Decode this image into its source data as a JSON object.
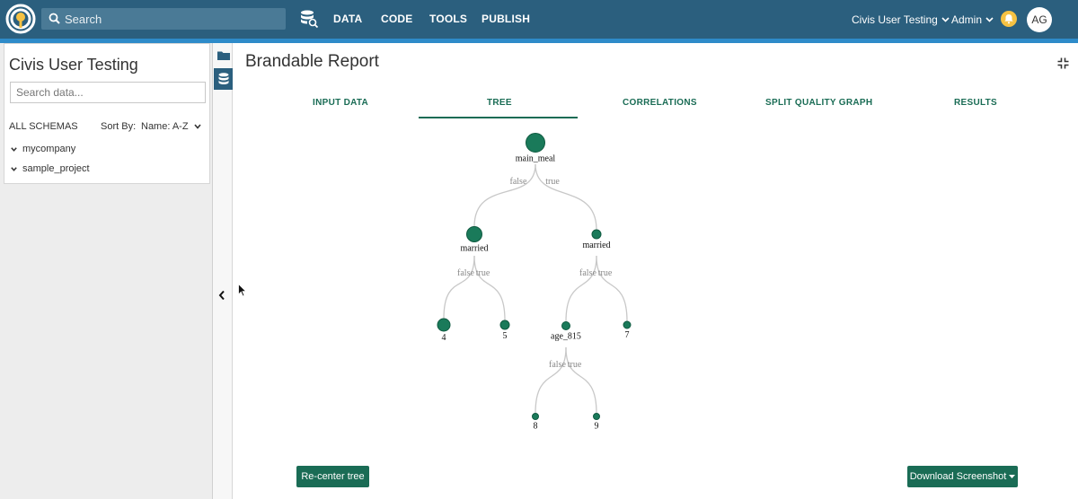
{
  "header": {
    "search_placeholder": "Search",
    "nav": [
      "DATA",
      "CODE",
      "TOOLS",
      "PUBLISH"
    ],
    "org_label": "Civis User Testing",
    "admin_label": "Admin",
    "avatar_initials": "AG"
  },
  "sidebar": {
    "title": "Civis User Testing",
    "search_placeholder": "Search data...",
    "all_schemas_label": "ALL SCHEMAS",
    "sort_by_label": "Sort By:",
    "sort_value": "Name: A-Z",
    "schemas": [
      "mycompany",
      "sample_project"
    ]
  },
  "report": {
    "title": "Brandable Report",
    "tabs": [
      "INPUT DATA",
      "TREE",
      "CORRELATIONS",
      "SPLIT QUALITY GRAPH",
      "RESULTS"
    ],
    "active_tab": "TREE",
    "recenter_label": "Re-center tree",
    "download_label": "Download Screenshot"
  },
  "tree": {
    "node_color": "#1a7a5a",
    "edge_color": "#c8c8c8",
    "nodes": [
      {
        "id": "n1",
        "label": "main_meal"
      },
      {
        "id": "n2",
        "label": "married"
      },
      {
        "id": "n3",
        "label": "married"
      },
      {
        "id": "n4",
        "label": "4"
      },
      {
        "id": "n5",
        "label": "5"
      },
      {
        "id": "n6",
        "label": "age_815"
      },
      {
        "id": "n7",
        "label": "7"
      },
      {
        "id": "n8",
        "label": "8"
      },
      {
        "id": "n9",
        "label": "9"
      }
    ],
    "edges": [
      {
        "from": "n1",
        "to": "n2",
        "label": "false"
      },
      {
        "from": "n1",
        "to": "n3",
        "label": "true"
      },
      {
        "from": "n2",
        "to": "n4",
        "label": "false"
      },
      {
        "from": "n2",
        "to": "n5",
        "label": "true"
      },
      {
        "from": "n3",
        "to": "n6",
        "label": "false"
      },
      {
        "from": "n3",
        "to": "n7",
        "label": "true"
      },
      {
        "from": "n6",
        "to": "n8",
        "label": "false"
      },
      {
        "from": "n6",
        "to": "n9",
        "label": "true"
      }
    ]
  },
  "colors": {
    "header_bg": "#2b5f7e",
    "header_stripe": "#2e8bc9",
    "accent_green": "#1a6c55",
    "bell": "#f6c243"
  },
  "icons": [
    "logo-icon",
    "search-icon",
    "database-search-icon",
    "chevron-down-icon",
    "bell-icon",
    "folder-icon",
    "database-icon",
    "chevron-left-icon",
    "fullscreen-exit-icon",
    "caret-down-icon",
    "mouse-cursor-icon"
  ]
}
